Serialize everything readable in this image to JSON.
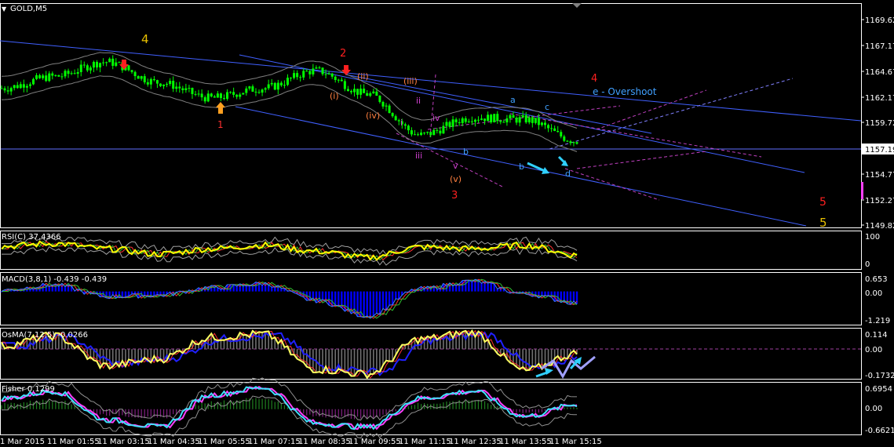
{
  "window": {
    "symbol_label": "GOLD,M5",
    "menu_glyph": "▼"
  },
  "main_panel": {
    "price_ticks": [
      "1169.62",
      "1167.17",
      "1164.67",
      "1162.17",
      "1159.72",
      "1157.19",
      "1154.77",
      "1152.27",
      "1149.82"
    ],
    "current_price": "1157.19",
    "wave_labels": [
      {
        "text": "4",
        "color": "#e8c000"
      },
      {
        "text": "2",
        "color": "#ff2020"
      },
      {
        "text": "1",
        "color": "#ff3030"
      },
      {
        "text": "(i)",
        "color": "#ff8040"
      },
      {
        "text": "(ii)",
        "color": "#ff8040"
      },
      {
        "text": "(iii)",
        "color": "#ff8040"
      },
      {
        "text": "(iv)",
        "color": "#ff8040"
      },
      {
        "text": "(v)",
        "color": "#ff8040"
      },
      {
        "text": "3",
        "color": "#ff2020"
      },
      {
        "text": "i",
        "color": "#d040d0"
      },
      {
        "text": "ii",
        "color": "#d040d0"
      },
      {
        "text": "iii",
        "color": "#d040d0"
      },
      {
        "text": "iv",
        "color": "#d040d0"
      },
      {
        "text": "v",
        "color": "#d040d0"
      },
      {
        "text": "a",
        "color": "#40a0ff"
      },
      {
        "text": "b",
        "color": "#40a0ff"
      },
      {
        "text": "c",
        "color": "#40a0ff"
      },
      {
        "text": "b",
        "color": "#40a0ff"
      },
      {
        "text": "d",
        "color": "#40a0ff"
      },
      {
        "text": "4",
        "color": "#ff2020"
      },
      {
        "text": "e - Overshoot",
        "color": "#40a0ff"
      },
      {
        "text": "5",
        "color": "#ff2020"
      },
      {
        "text": "5",
        "color": "#e8c000"
      }
    ]
  },
  "indicators": [
    {
      "name": "rsi",
      "label": "RSI(C)  ",
      "value": "37.4366",
      "ticks": [
        "100",
        "0"
      ]
    },
    {
      "name": "macd",
      "label": "MACD(3,8,1)",
      "value": "-0.439 -0.439",
      "ticks": [
        "0.653",
        "0.00",
        "-1.219"
      ]
    },
    {
      "name": "osma",
      "label": "OsMA(7,12,5)",
      "value": "-0.0266",
      "ticks": [
        "0.114",
        "0.00",
        "-0.1732"
      ]
    },
    {
      "name": "fisher",
      "label": "Fisher",
      "value": "0.1299",
      "ticks": [
        "0.6954",
        "0.00",
        "-0.6621"
      ]
    }
  ],
  "time_axis": [
    "1 Mar 2015",
    "11 Mar 01:55",
    "11 Mar 03:15",
    "11 Mar 04:35",
    "11 Mar 05:55",
    "11 Mar 07:15",
    "11 Mar 08:35",
    "11 Mar 09:55",
    "11 Mar 11:15",
    "11 Mar 12:35",
    "11 Mar 13:55",
    "11 Mar 15:15"
  ],
  "colors": {
    "candle": "#00ff00",
    "trendline": "#4060ff",
    "rsi": "#ffff00",
    "macd_hist": "#0000ff",
    "osma_line": "#ffff60",
    "fisher_line": "#40e0ff",
    "arrow_cyan": "#30d0ff"
  },
  "chart_data": [
    {
      "type": "candlestick",
      "title": "GOLD,M5",
      "ylim": [
        1148.5,
        1171.0
      ],
      "x": [
        "1 Mar 2015",
        "11 Mar 01:55",
        "11 Mar 03:15",
        "11 Mar 04:35",
        "11 Mar 05:55",
        "11 Mar 07:15",
        "11 Mar 08:35",
        "11 Mar 09:55",
        "11 Mar 11:15",
        "11 Mar 12:35",
        "11 Mar 13:55",
        "11 Mar 15:15"
      ],
      "price_path": [
        1162.6,
        1163.8,
        1165.3,
        1163.2,
        1161.6,
        1162.6,
        1164.4,
        1162.0,
        1157.8,
        1159.6,
        1159.4,
        1157.2
      ],
      "current_price": 1157.19
    },
    {
      "type": "line",
      "title": "RSI(C) 37.4366",
      "ylim": [
        0,
        100
      ],
      "series": [
        {
          "name": "RSI(C)",
          "values": [
            62,
            70,
            55,
            40,
            55,
            65,
            48,
            30,
            60,
            55,
            65,
            37
          ]
        }
      ]
    },
    {
      "type": "bar",
      "title": "MACD(3,8,1) -0.439 -0.439",
      "ylim": [
        -1.219,
        0.653
      ],
      "series": [
        {
          "name": "MACD(3,8,1)",
          "values": [
            0.05,
            0.25,
            -0.2,
            -0.15,
            0.15,
            0.3,
            -0.35,
            -0.95,
            0.1,
            0.4,
            -0.1,
            -0.439
          ]
        }
      ]
    },
    {
      "type": "line",
      "title": "OsMA(7,12,5) -0.0266",
      "ylim": [
        -0.1732,
        0.114
      ],
      "series": [
        {
          "name": "OsMA(7,12,5)",
          "values": [
            0.02,
            0.08,
            -0.1,
            -0.06,
            0.07,
            0.09,
            -0.12,
            -0.15,
            0.06,
            0.1,
            -0.13,
            -0.0266
          ]
        }
      ]
    },
    {
      "type": "line",
      "title": "Fisher 0.1299",
      "ylim": [
        -0.6621,
        0.6954
      ],
      "series": [
        {
          "name": "Fisher",
          "values": [
            0.3,
            0.5,
            -0.3,
            -0.5,
            0.4,
            0.6,
            -0.4,
            -0.5,
            0.3,
            0.5,
            -0.2,
            0.1299
          ]
        }
      ]
    }
  ]
}
